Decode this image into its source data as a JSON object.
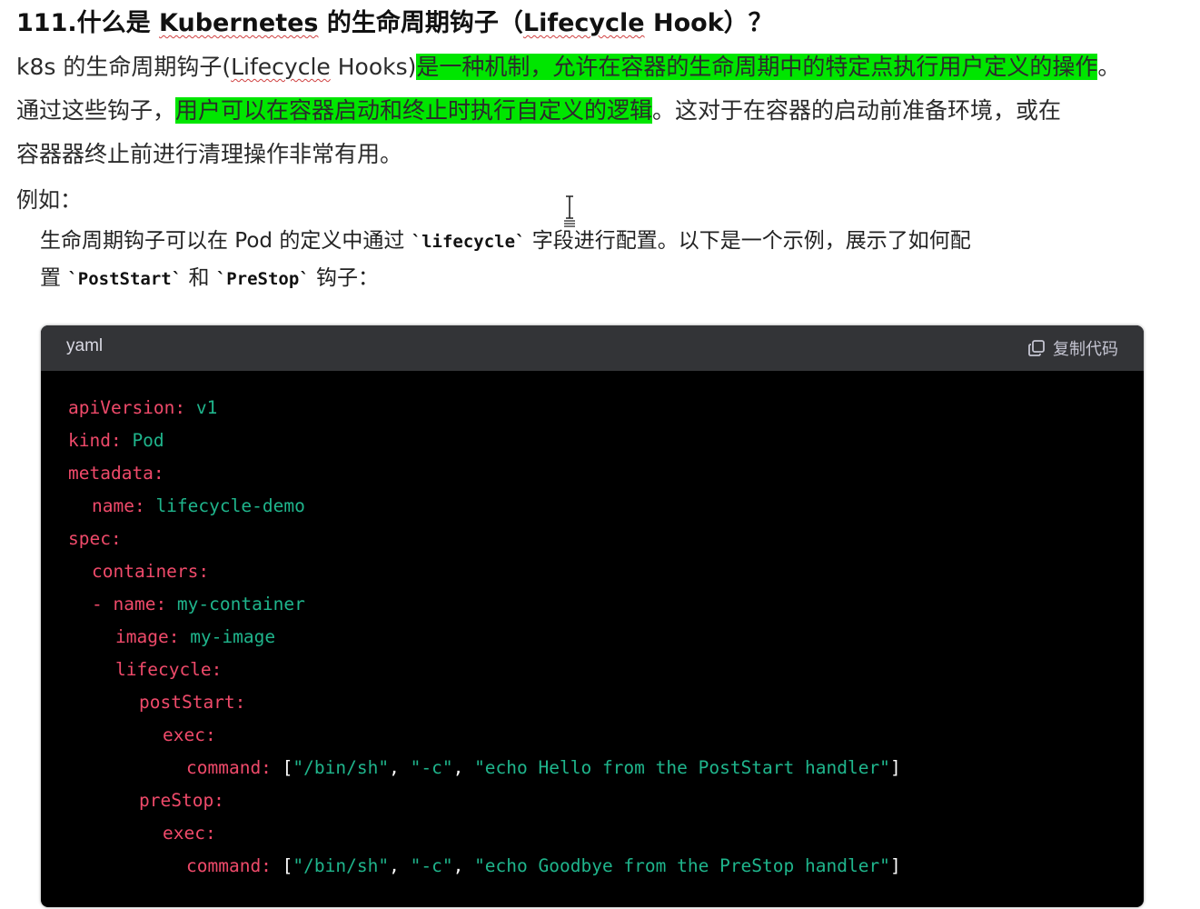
{
  "title": {
    "prefix": "111.什么是 ",
    "kubernetes": "Kubernetes",
    "middle": " 的生命周期钩子（",
    "lifecycle": "Lifecycle",
    "suffix": " Hook）？"
  },
  "para1": {
    "text1": "k8s 的生命周期钩子(",
    "lifecycle": "Lifecycle",
    "text2": " Hooks)",
    "highlight": "是一种机制，允许在容器的生命周期中的特定点执行用户定义的操作",
    "end": "。"
  },
  "para2": {
    "text1": "通过这些钩子，",
    "highlight": "用户可以在容器启动和终止时执行自定义的逻辑",
    "text2": "。这对于在容器的启动前准备环境，或在"
  },
  "para3": "容器器终止前进行清理操作非常有用。",
  "para4": "例如：",
  "sub1": {
    "text1": "生命周期钩子可以在 Pod 的定义中通过 ",
    "code": "`lifecycle`",
    "text2": " 字段进行配置。以下是一个示例，展示了如何配"
  },
  "sub2": {
    "text1": "置 ",
    "code1": "`PostStart`",
    "text2": " 和 ",
    "code2": "`PreStop`",
    "text3": " 钩子："
  },
  "codeblock": {
    "language": "yaml",
    "copy_label": "复制代码",
    "lines": [
      {
        "indent": "",
        "key": "apiVersion:",
        "val": " v1"
      },
      {
        "indent": "",
        "key": "kind:",
        "val": " Pod"
      },
      {
        "indent": "",
        "key": "metadata:",
        "val": ""
      },
      {
        "indent": "  ",
        "key": "name:",
        "val": " lifecycle-demo"
      },
      {
        "indent": "",
        "key": "spec:",
        "val": ""
      },
      {
        "indent": "  ",
        "key": "containers:",
        "val": ""
      },
      {
        "indent": "  ",
        "key": "- name:",
        "val": " my-container"
      },
      {
        "indent": "    ",
        "key": "image:",
        "val": " my-image"
      },
      {
        "indent": "    ",
        "key": "lifecycle:",
        "val": ""
      },
      {
        "indent": "      ",
        "key": "postStart:",
        "val": ""
      },
      {
        "indent": "        ",
        "key": "exec:",
        "val": ""
      },
      {
        "indent": "          ",
        "key": "command:",
        "val": " [\"/bin/sh\", \"-c\", \"echo Hello from the PostStart handler\"]"
      },
      {
        "indent": "      ",
        "key": "preStop:",
        "val": ""
      },
      {
        "indent": "        ",
        "key": "exec:",
        "val": ""
      },
      {
        "indent": "          ",
        "key": "command:",
        "val": " [\"/bin/sh\", \"-c\", \"echo Goodbye from the PreStop handler\"]"
      }
    ]
  }
}
